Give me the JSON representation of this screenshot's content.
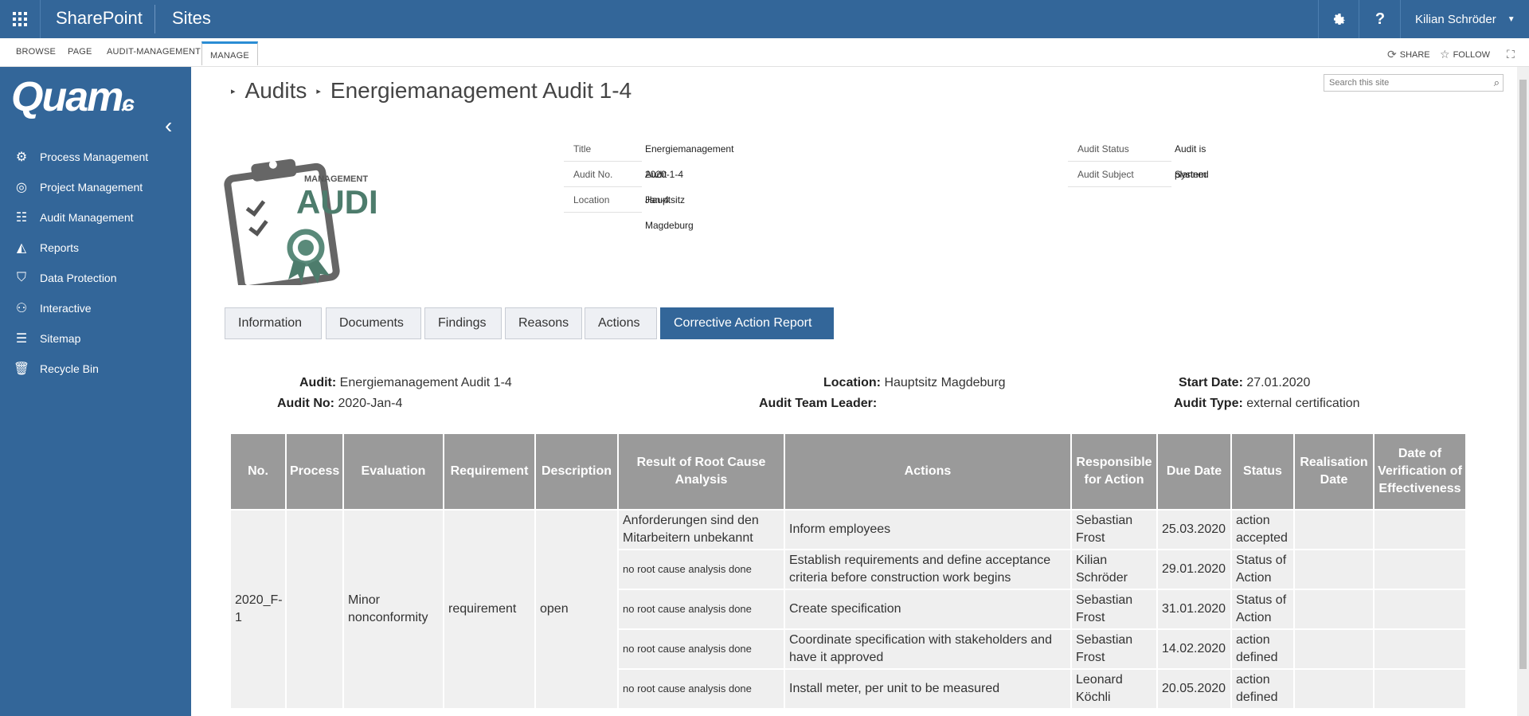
{
  "topbar": {
    "brand": "SharePoint",
    "sites": "Sites",
    "settings_icon": "gear-icon",
    "help_label": "?",
    "user_name": "Kilian Schröder"
  },
  "ribbon": {
    "tabs": [
      "BROWSE",
      "PAGE",
      "AUDIT-MANAGEMENT",
      "MANAGE"
    ],
    "active_tab": "MANAGE",
    "share": "SHARE",
    "follow": "FOLLOW"
  },
  "sidebar": {
    "logo": "Quam",
    "items": [
      {
        "label": "Process Management",
        "icon": "settings-gear-icon"
      },
      {
        "label": "Project Management",
        "icon": "globe-icon"
      },
      {
        "label": "Audit Management",
        "icon": "checklist-icon"
      },
      {
        "label": "Reports",
        "icon": "chart-icon"
      },
      {
        "label": "Data Protection",
        "icon": "shield-icon"
      },
      {
        "label": "Interactive",
        "icon": "people-icon"
      },
      {
        "label": "Sitemap",
        "icon": "sitemap-icon"
      },
      {
        "label": "Recycle Bin",
        "icon": "trash-icon"
      }
    ]
  },
  "breadcrumb": {
    "parent": "Audits",
    "current": "Energiemanagement Audit 1-4"
  },
  "search": {
    "placeholder": "Search this site"
  },
  "audit_logo": {
    "small": "MANAGEMENT",
    "big": "AUDIT"
  },
  "properties": {
    "left": [
      {
        "label": "Title",
        "value": "Energiemanagement Audit 1-4"
      },
      {
        "label": "Audit No.",
        "value": "2020-Jan-4"
      },
      {
        "label": "Location",
        "value": "Hauptsitz Magdeburg"
      }
    ],
    "right": [
      {
        "label": "Audit Status",
        "value": "Audit is planned"
      },
      {
        "label": "Audit Subject",
        "value": "System"
      }
    ]
  },
  "tabs": [
    "Information",
    "Documents",
    "Findings",
    "Reasons",
    "Actions",
    "Corrective Action Report"
  ],
  "active_tab": "Corrective Action Report",
  "report_header": {
    "audit_label": "Audit:",
    "audit_value": "Energiemanagement Audit 1-4",
    "audit_no_label": "Audit No:",
    "audit_no_value": "2020-Jan-4",
    "location_label": "Location:",
    "location_value": "Hauptsitz Magdeburg",
    "team_leader_label": "Audit Team Leader:",
    "team_leader_value": "",
    "start_date_label": "Start Date:",
    "start_date_value": "27.01.2020",
    "audit_type_label": "Audit Type:",
    "audit_type_value": "external certification"
  },
  "table": {
    "headers": [
      "No.",
      "Process",
      "Evaluation",
      "Requirement",
      "Description",
      "Result of Root Cause Analysis",
      "Actions",
      "Responsible for Action",
      "Due Date",
      "Status",
      "Realisation Date",
      "Date of Verification of Effectiveness"
    ],
    "finding": {
      "no": "2020_F-1",
      "process": "",
      "evaluation": "Minor nonconformity",
      "requirement": "requirement",
      "description": "open"
    },
    "rows": [
      {
        "root_cause": "Anforderungen sind den Mitarbeitern unbekannt",
        "action": "Inform employees",
        "responsible": "Sebastian Frost",
        "due": "25.03.2020",
        "status": "action accepted",
        "realisation": "",
        "verification": ""
      },
      {
        "root_cause": "no root cause analysis done",
        "action": "Establish requirements and define acceptance criteria before construction work begins",
        "responsible": "Kilian Schröder",
        "due": "29.01.2020",
        "status": "Status of Action",
        "realisation": "",
        "verification": ""
      },
      {
        "root_cause": "no root cause analysis done",
        "action": "Create specification",
        "responsible": "Sebastian Frost",
        "due": "31.01.2020",
        "status": "Status of Action",
        "realisation": "",
        "verification": ""
      },
      {
        "root_cause": "no root cause analysis done",
        "action": "Coordinate specification with stakeholders and have it approved",
        "responsible": "Sebastian Frost",
        "due": "14.02.2020",
        "status": "action defined",
        "realisation": "",
        "verification": ""
      },
      {
        "root_cause": "no root cause analysis done",
        "action": "Install meter, per unit to be measured",
        "responsible": "Leonard Köchli",
        "due": "20.05.2020",
        "status": "action defined",
        "realisation": "",
        "verification": ""
      }
    ]
  }
}
